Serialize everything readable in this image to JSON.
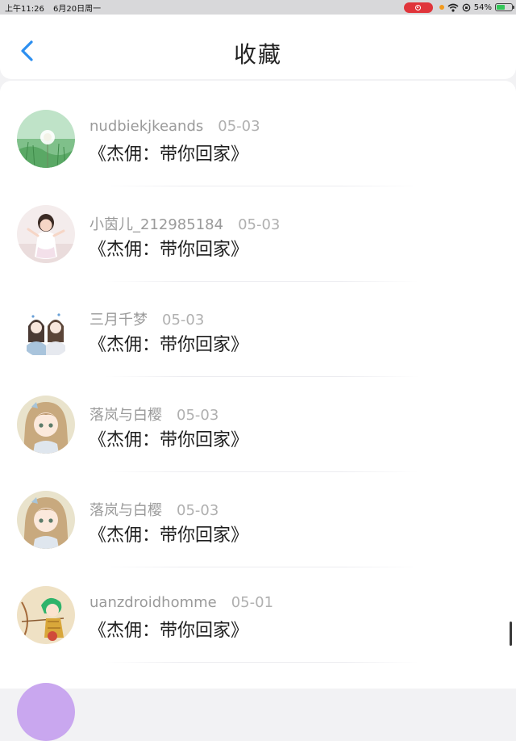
{
  "status_bar": {
    "time": "上午11:26",
    "date": "6月20日周一",
    "battery": "54%",
    "battery_level": 0.54
  },
  "header": {
    "title": "收藏"
  },
  "items": [
    {
      "user": "nudbiekjkeands",
      "date": "05-03",
      "title": "《杰佣：带你回家》",
      "avatar": "dandelion-avatar"
    },
    {
      "user": "小茵儿_212985184",
      "date": "05-03",
      "title": "《杰佣：带你回家》",
      "avatar": "girl-photo-avatar"
    },
    {
      "user": "三月千梦",
      "date": "05-03",
      "title": "《杰佣：带你回家》",
      "avatar": "two-girls-drawing-avatar"
    },
    {
      "user": "落岚与白樱",
      "date": "05-03",
      "title": "《杰佣：带你回家》",
      "avatar": "anime-girl-avatar"
    },
    {
      "user": "落岚与白樱",
      "date": "05-03",
      "title": "《杰佣：带你回家》",
      "avatar": "anime-girl-avatar"
    },
    {
      "user": "uanzdroidhomme",
      "date": "05-01",
      "title": "《杰佣：带你回家》",
      "avatar": "green-hair-archer-avatar"
    }
  ]
}
